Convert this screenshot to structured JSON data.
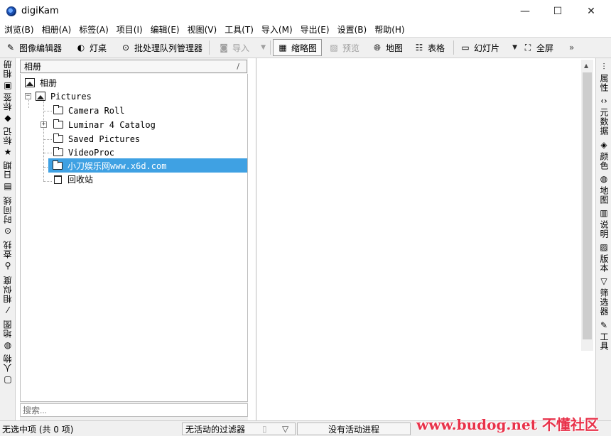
{
  "window": {
    "title": "digiKam",
    "minimize": "—",
    "maximize": "☐",
    "close": "✕"
  },
  "menu": [
    "浏览(B)",
    "相册(A)",
    "标签(A)",
    "项目(I)",
    "编辑(E)",
    "视图(V)",
    "工具(T)",
    "导入(M)",
    "导出(E)",
    "设置(B)",
    "帮助(H)"
  ],
  "toolbar": {
    "image_editor": "图像编辑器",
    "light_table": "灯桌",
    "batch_queue": "批处理队列管理器",
    "import": "导入",
    "thumbnails": "缩略图",
    "preview": "预览",
    "map": "地图",
    "table": "表格",
    "slideshow": "幻灯片",
    "fullscreen": "全屏",
    "more": "»"
  },
  "left_tabs": [
    {
      "label": "相册",
      "icon": "image-icon"
    },
    {
      "label": "标签",
      "icon": "tag-icon"
    },
    {
      "label": "标记",
      "icon": "star-icon"
    },
    {
      "label": "日期",
      "icon": "calendar-icon"
    },
    {
      "label": "时间线",
      "icon": "clock-icon"
    },
    {
      "label": "查找",
      "icon": "search-icon"
    },
    {
      "label": "相似度",
      "icon": "wand-icon"
    },
    {
      "label": "地图",
      "icon": "globe-icon"
    },
    {
      "label": "人物",
      "icon": "person-icon"
    }
  ],
  "right_tabs": [
    {
      "label": "属性",
      "icon": "sliders-icon"
    },
    {
      "label": "元数据",
      "icon": "code-icon"
    },
    {
      "label": "颜色",
      "icon": "fill-icon"
    },
    {
      "label": "地图",
      "icon": "globe-icon"
    },
    {
      "label": "说明",
      "icon": "note-icon"
    },
    {
      "label": "版本",
      "icon": "versions-icon"
    },
    {
      "label": "筛选器",
      "icon": "filter-icon"
    },
    {
      "label": "工具",
      "icon": "pencil-icon"
    }
  ],
  "album_panel": {
    "header": "相册",
    "root": "相册",
    "pictures": "Pictures",
    "folders": [
      "Camera Roll",
      "Luminar 4 Catalog",
      "Saved Pictures",
      "VideoProc",
      "小刀娱乐网www.x6d.com"
    ],
    "trash": "回收站",
    "search_placeholder": "搜索..."
  },
  "status": {
    "selection": "无选中项 (共 0 项)",
    "filter": "无活动的过滤器",
    "process": "没有活动进程"
  },
  "watermark": "www.budog.net 不懂社区"
}
